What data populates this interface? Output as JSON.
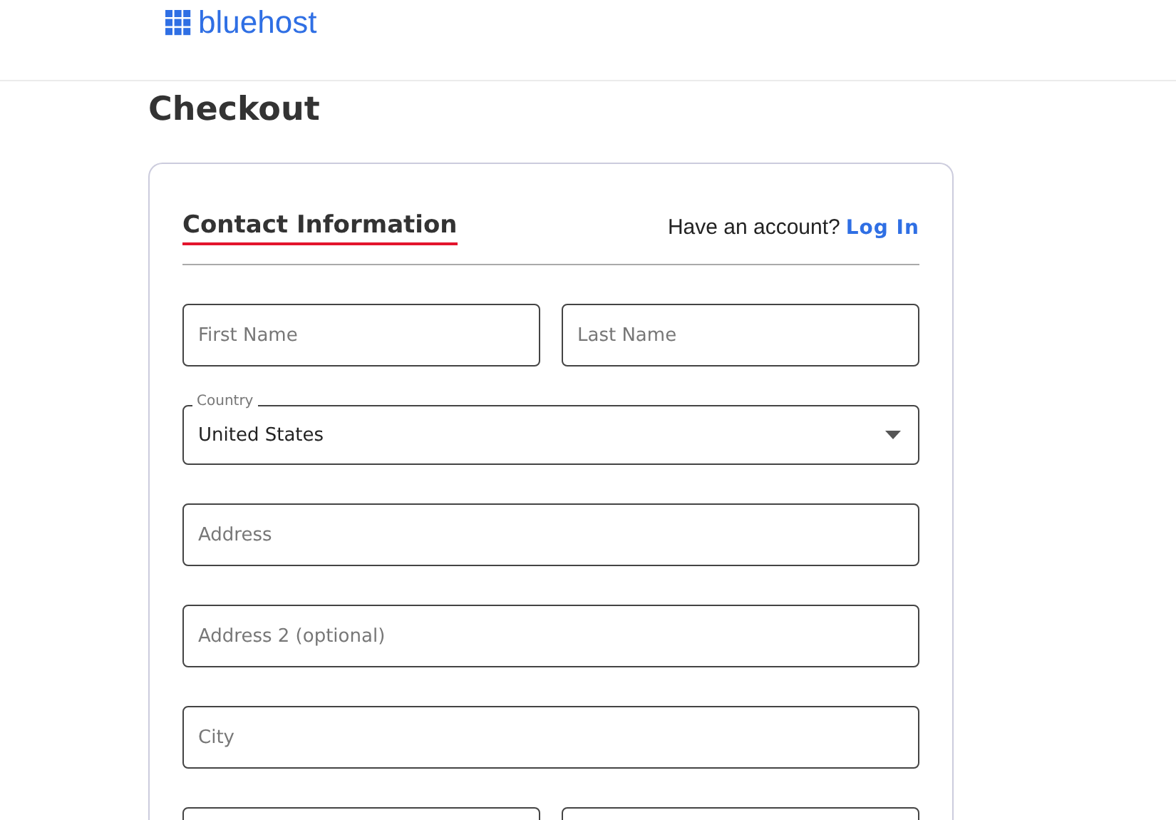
{
  "header": {
    "logo_text": "bluehost"
  },
  "page_title": "Checkout",
  "contact": {
    "heading": "Contact Information",
    "account_prompt": "Have an account?",
    "login_link": "Log In"
  },
  "rows": [
    {
      "fields": [
        {
          "kind": "text",
          "placeholder": "First Name"
        },
        {
          "kind": "text",
          "placeholder": "Last Name"
        }
      ]
    },
    {
      "fields": [
        {
          "kind": "select",
          "label": "Country",
          "value": "United States"
        }
      ]
    },
    {
      "fields": [
        {
          "kind": "text",
          "placeholder": "Address"
        }
      ]
    },
    {
      "fields": [
        {
          "kind": "text",
          "placeholder": "Address 2 (optional)"
        }
      ]
    },
    {
      "fields": [
        {
          "kind": "text",
          "placeholder": "City"
        }
      ]
    }
  ]
}
